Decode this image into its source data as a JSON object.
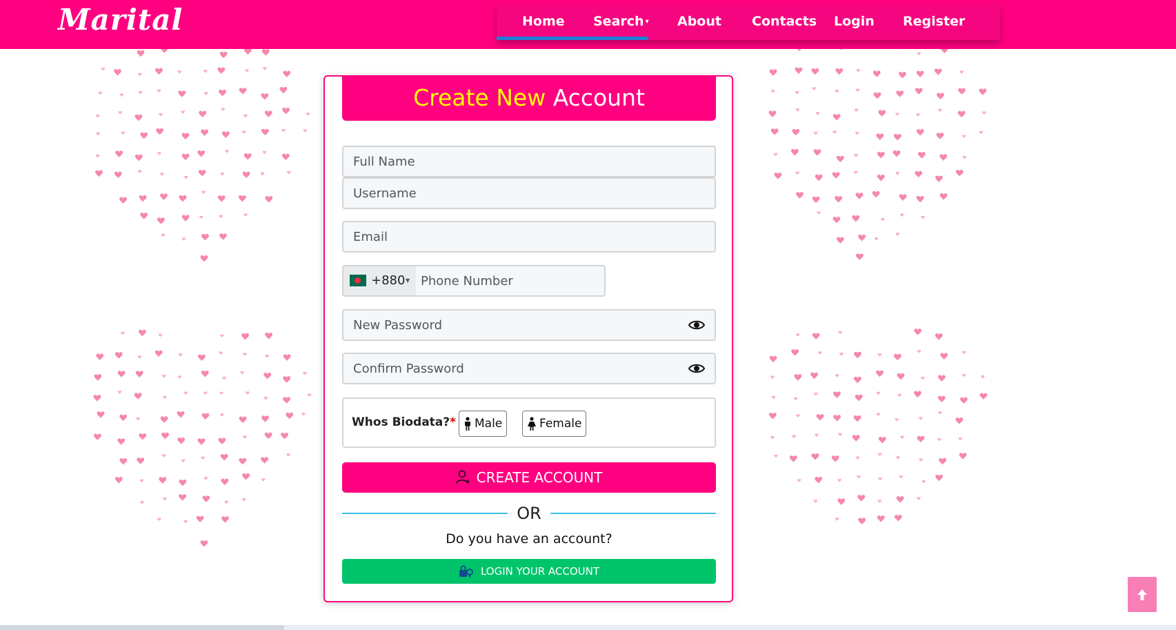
{
  "header": {
    "logo": "Marital",
    "nav": {
      "home": "Home",
      "search": "Search",
      "about": "About",
      "contacts": "Contacts",
      "login": "Login",
      "register": "Register"
    }
  },
  "form": {
    "title_highlight": "Create New",
    "title_rest": "Account",
    "full_name_placeholder": "Full Name",
    "username_placeholder": "Username",
    "email_placeholder": "Email",
    "phone": {
      "dial_code": "+880",
      "placeholder": "Phone Number"
    },
    "new_password_placeholder": "New Password",
    "confirm_password_placeholder": "Confirm Password",
    "biodata": {
      "label": "Whos Biodata?",
      "required_mark": "*",
      "male": "Male",
      "female": "Female"
    },
    "create_button": "CREATE ACCOUNT",
    "or_text": "OR",
    "have_account": "Do you have an account?",
    "login_button": "LOGIN YOUR ACCOUNT"
  },
  "colors": {
    "brand_pink": "#ff0080",
    "title_yellow": "#ffff00",
    "login_green": "#00c46a",
    "nav_underline": "#1f7fd6"
  }
}
